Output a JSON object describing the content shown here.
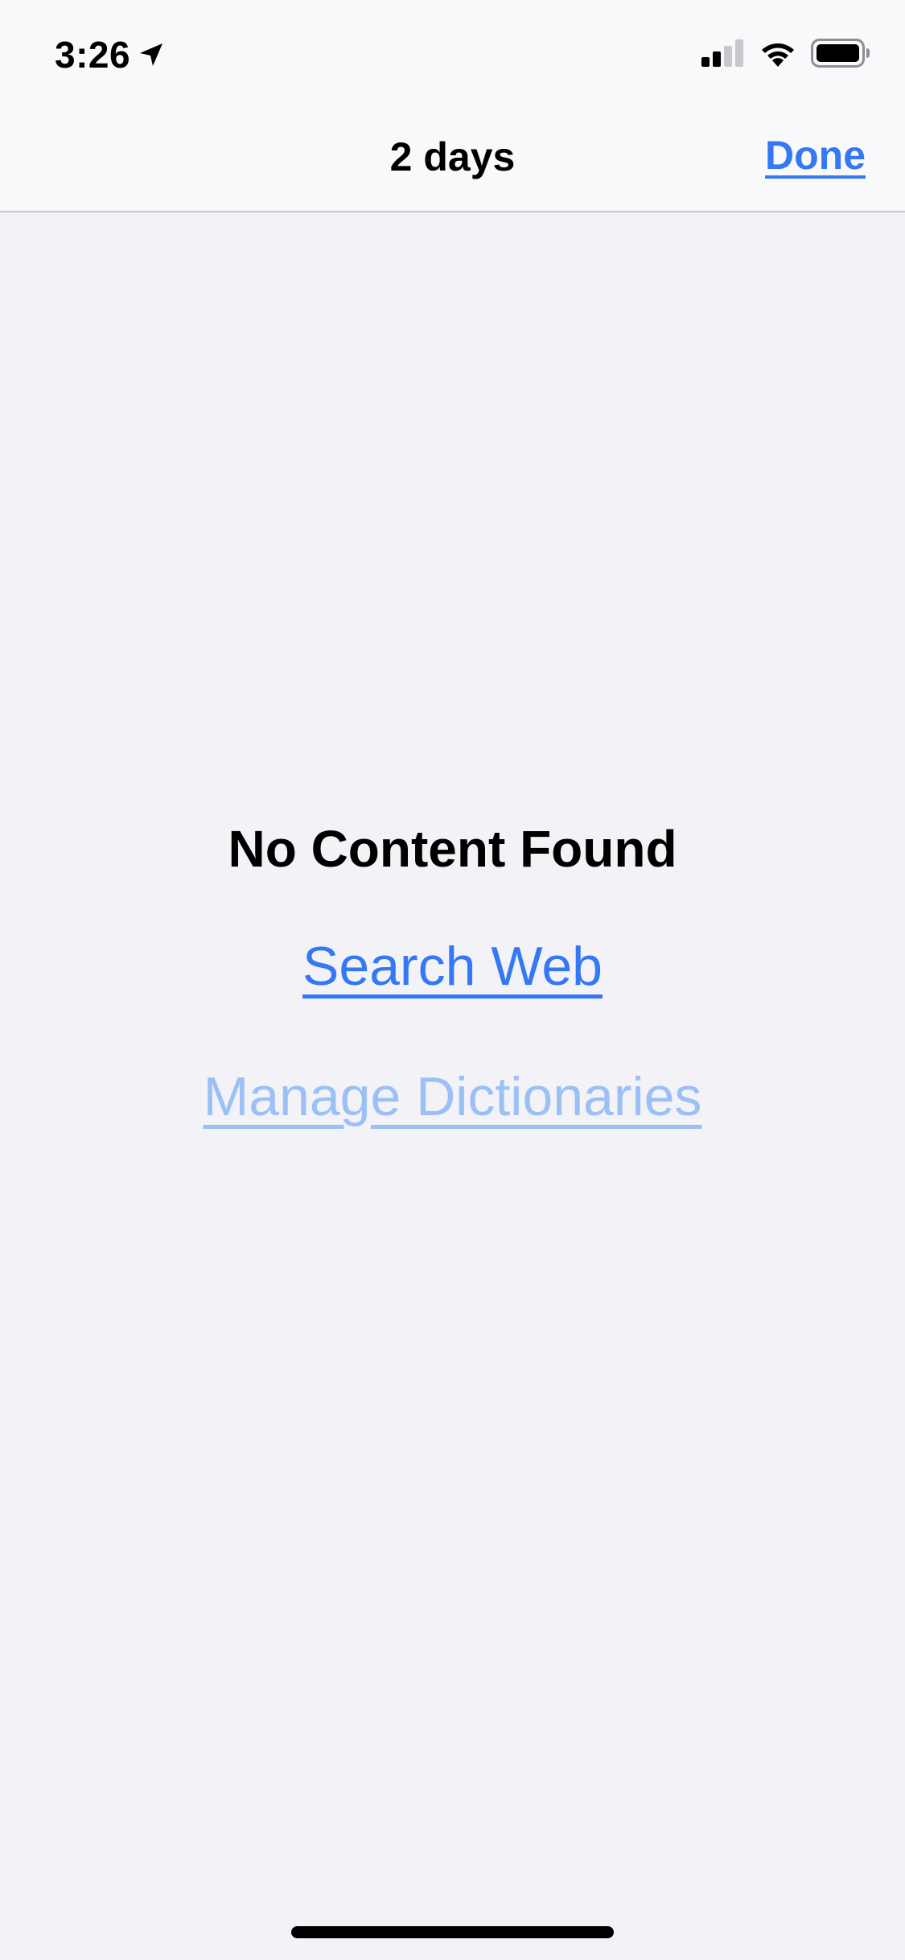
{
  "status_bar": {
    "time": "3:26",
    "location_icon": "location-arrow-icon",
    "signal_icon": "cellular-signal-icon",
    "wifi_icon": "wifi-icon",
    "battery_icon": "battery-icon"
  },
  "nav": {
    "title": "2 days",
    "done_label": "Done"
  },
  "empty_state": {
    "title": "No Content Found",
    "search_web_label": "Search Web",
    "manage_dictionaries_label": "Manage Dictionaries"
  },
  "colors": {
    "accent": "#3478f6",
    "accent_disabled": "#9ac0f5",
    "background": "#f2f2f7",
    "bar_background": "#f9f9fb"
  }
}
